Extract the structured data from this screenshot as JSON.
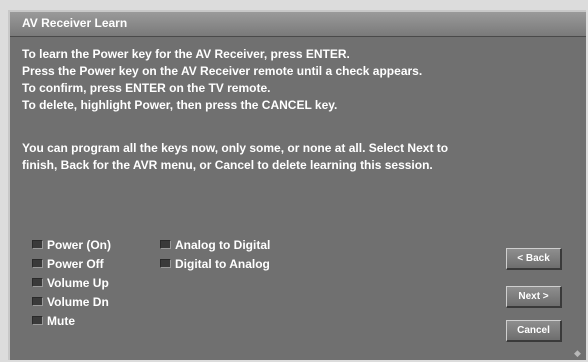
{
  "window": {
    "title": "AV Receiver Learn"
  },
  "instructions": [
    "To learn the Power key for the AV Receiver, press ENTER.",
    "Press the Power key on the AV Receiver remote until a check appears.",
    "To confirm, press ENTER on the TV remote.",
    "To delete, highlight Power, then press the CANCEL key."
  ],
  "program_info": [
    "You can program all the keys now, only some, or none at all. Select Next to",
    "finish, Back for the AVR menu, or Cancel to delete learning this session."
  ],
  "keys_left": [
    {
      "label": "Power (On)",
      "checked": false
    },
    {
      "label": "Power Off",
      "checked": false
    },
    {
      "label": "Volume Up",
      "checked": false
    },
    {
      "label": "Volume Dn",
      "checked": false
    },
    {
      "label": "Mute",
      "checked": false
    }
  ],
  "keys_right": [
    {
      "label": "Analog to Digital",
      "checked": false
    },
    {
      "label": "Digital to Analog",
      "checked": false
    }
  ],
  "buttons": {
    "back": "< Back",
    "next": "Next >",
    "cancel": "Cancel"
  },
  "colors": {
    "panel": "#707070",
    "titlebar": "#8a8a8a",
    "text": "#ffffff"
  }
}
